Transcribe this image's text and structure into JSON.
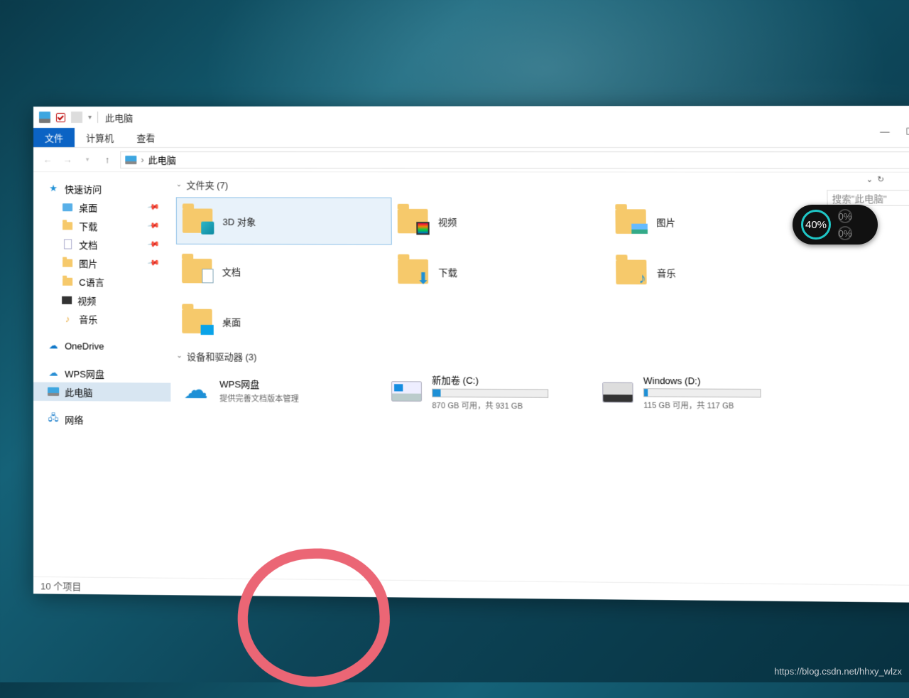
{
  "window": {
    "title": "此电脑",
    "location": "此电脑",
    "search_placeholder": "搜索\"此电脑\""
  },
  "ribbon": {
    "file": "文件",
    "computer": "计算机",
    "view": "查看"
  },
  "sidebar": {
    "quick": "快速访问",
    "items": [
      "桌面",
      "下载",
      "文档",
      "图片",
      "C语言",
      "视频",
      "音乐"
    ],
    "onedrive": "OneDrive",
    "wps": "WPS网盘",
    "thispc": "此电脑",
    "network": "网络"
  },
  "sections": {
    "folders_hdr": "文件夹 (7)",
    "folders": [
      "3D 对象",
      "视频",
      "图片",
      "文档",
      "下载",
      "音乐",
      "桌面"
    ],
    "devices_hdr": "设备和驱动器 (3)",
    "wps": {
      "name": "WPS网盘",
      "sub": "提供完善文档版本管理"
    },
    "c": {
      "name": "新加卷 (C:)",
      "sub": "870 GB 可用，共 931 GB",
      "pct": 7
    },
    "d": {
      "name": "Windows (D:)",
      "sub": "115 GB 可用，共 117 GB",
      "pct": 3
    }
  },
  "status": "10 个项目",
  "gauge": {
    "main": "40%",
    "s1": "0%",
    "s2": "0%"
  },
  "watermark": "https://blog.csdn.net/hhxy_wlzx"
}
